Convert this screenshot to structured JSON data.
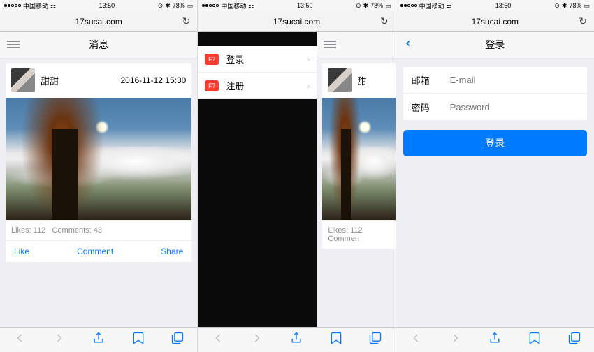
{
  "statusbar": {
    "carrier": "中国移动",
    "signal_icon": "wifi",
    "time": "13:50",
    "alarm": "⏰",
    "bt": "⚡",
    "battery_pct": "78%"
  },
  "urlbar": {
    "url": "17sucai.com",
    "reload": "↻"
  },
  "screen1": {
    "title": "消息",
    "post": {
      "username": "甜甜",
      "timestamp": "2016-11-12 15:30",
      "likes_label": "Likes: 112",
      "comments_label": "Comments: 43",
      "like_btn": "Like",
      "comment_btn": "Comment",
      "share_btn": "Share"
    }
  },
  "screen2": {
    "panel": {
      "badge": "F7",
      "items": [
        {
          "label": "登录"
        },
        {
          "label": "注册"
        }
      ]
    },
    "behind": {
      "username": "甜",
      "likes_label": "Likes: 112",
      "comments_label": "Commen"
    }
  },
  "screen3": {
    "title": "登录",
    "form": {
      "email_label": "邮箱",
      "email_placeholder": "E-mail",
      "password_label": "密码",
      "password_placeholder": "Password",
      "submit": "登录"
    }
  }
}
